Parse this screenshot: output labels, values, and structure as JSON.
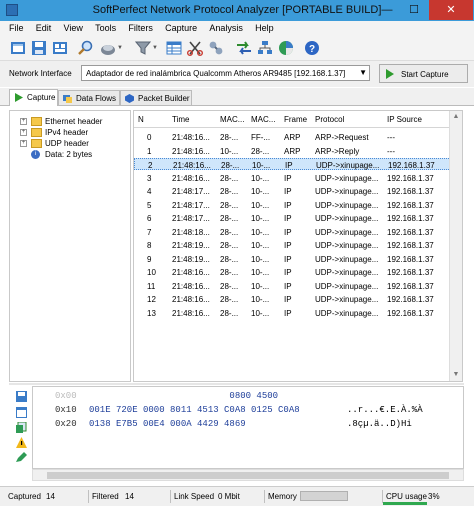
{
  "window": {
    "title": "SoftPerfect Network Protocol Analyzer [PORTABLE BUILD]",
    "minimize": "—",
    "maximize": "☐",
    "close": "✕"
  },
  "menu": [
    "File",
    "Edit",
    "View",
    "Tools",
    "Filters",
    "Capture",
    "Analysis",
    "Help"
  ],
  "network": {
    "label": "Network Interface",
    "value": "Adaptador de red inalámbrica Qualcomm Atheros AR9485 [192.168.1.37]",
    "start_label": "Start Capture"
  },
  "tabs": [
    {
      "label": "Capture"
    },
    {
      "label": "Data Flows"
    },
    {
      "label": "Packet Builder"
    }
  ],
  "tree": [
    {
      "label": "Ethernet header"
    },
    {
      "label": "IPv4 header"
    },
    {
      "label": "UDP header"
    },
    {
      "label": "Data: 2 bytes"
    }
  ],
  "columns": [
    "N",
    "Time",
    "MAC...",
    "MAC...",
    "Frame",
    "Protocol",
    "IP Source"
  ],
  "packets": [
    {
      "n": "0",
      "time": "21:48:16...",
      "mac1": "28-...",
      "mac2": "FF-...",
      "frame": "ARP",
      "protocol": "ARP->Request",
      "ip": "---"
    },
    {
      "n": "1",
      "time": "21:48:16...",
      "mac1": "10-...",
      "mac2": "28-...",
      "frame": "ARP",
      "protocol": "ARP->Reply",
      "ip": "---"
    },
    {
      "n": "2",
      "time": "21:48:16...",
      "mac1": "28-...",
      "mac2": "10-...",
      "frame": "IP",
      "protocol": "UDP->xinupage...",
      "ip": "192.168.1.37"
    },
    {
      "n": "3",
      "time": "21:48:16...",
      "mac1": "28-...",
      "mac2": "10-...",
      "frame": "IP",
      "protocol": "UDP->xinupage...",
      "ip": "192.168.1.37"
    },
    {
      "n": "4",
      "time": "21:48:17...",
      "mac1": "28-...",
      "mac2": "10-...",
      "frame": "IP",
      "protocol": "UDP->xinupage...",
      "ip": "192.168.1.37"
    },
    {
      "n": "5",
      "time": "21:48:17...",
      "mac1": "28-...",
      "mac2": "10-...",
      "frame": "IP",
      "protocol": "UDP->xinupage...",
      "ip": "192.168.1.37"
    },
    {
      "n": "6",
      "time": "21:48:17...",
      "mac1": "28-...",
      "mac2": "10-...",
      "frame": "IP",
      "protocol": "UDP->xinupage...",
      "ip": "192.168.1.37"
    },
    {
      "n": "7",
      "time": "21:48:18...",
      "mac1": "28-...",
      "mac2": "10-...",
      "frame": "IP",
      "protocol": "UDP->xinupage...",
      "ip": "192.168.1.37"
    },
    {
      "n": "8",
      "time": "21:48:19...",
      "mac1": "28-...",
      "mac2": "10-...",
      "frame": "IP",
      "protocol": "UDP->xinupage...",
      "ip": "192.168.1.37"
    },
    {
      "n": "9",
      "time": "21:48:19...",
      "mac1": "28-...",
      "mac2": "10-...",
      "frame": "IP",
      "protocol": "UDP->xinupage...",
      "ip": "192.168.1.37"
    },
    {
      "n": "10",
      "time": "21:48:16...",
      "mac1": "28-...",
      "mac2": "10-...",
      "frame": "IP",
      "protocol": "UDP->xinupage...",
      "ip": "192.168.1.37"
    },
    {
      "n": "11",
      "time": "21:48:16...",
      "mac1": "28-...",
      "mac2": "10-...",
      "frame": "IP",
      "protocol": "UDP->xinupage...",
      "ip": "192.168.1.37"
    },
    {
      "n": "12",
      "time": "21:48:16...",
      "mac1": "28-...",
      "mac2": "10-...",
      "frame": "IP",
      "protocol": "UDP->xinupage...",
      "ip": "192.168.1.37"
    },
    {
      "n": "13",
      "time": "21:48:16...",
      "mac1": "28-...",
      "mac2": "10-...",
      "frame": "IP",
      "protocol": "UDP->xinupage...",
      "ip": "192.168.1.37"
    }
  ],
  "selected_packet": "2",
  "hex": [
    {
      "offset": "0x00",
      "hex": "                          0800 4500",
      "ascii": ""
    },
    {
      "offset": "0x10",
      "hex": "001E 720E 0000 8011 4513 C0A8 0125 C0A8",
      "ascii": "..r...€.E.À.%À"
    },
    {
      "offset": "0x20",
      "hex": "0138 E7B5 00E4 000A 4429 4869",
      "ascii": ".8çµ.ä..D)Hi"
    }
  ],
  "status": {
    "captured_label": "Captured",
    "captured": "14",
    "filtered_label": "Filtered",
    "filtered": "14",
    "link_label": "Link Speed",
    "link": "0 Mbit",
    "memory_label": "Memory",
    "cpu_label": "CPU usage",
    "cpu": "3%"
  },
  "colors": {
    "titlebar": "#3b9bd9",
    "selection": "#cfe6fb",
    "close": "#c7372f"
  }
}
